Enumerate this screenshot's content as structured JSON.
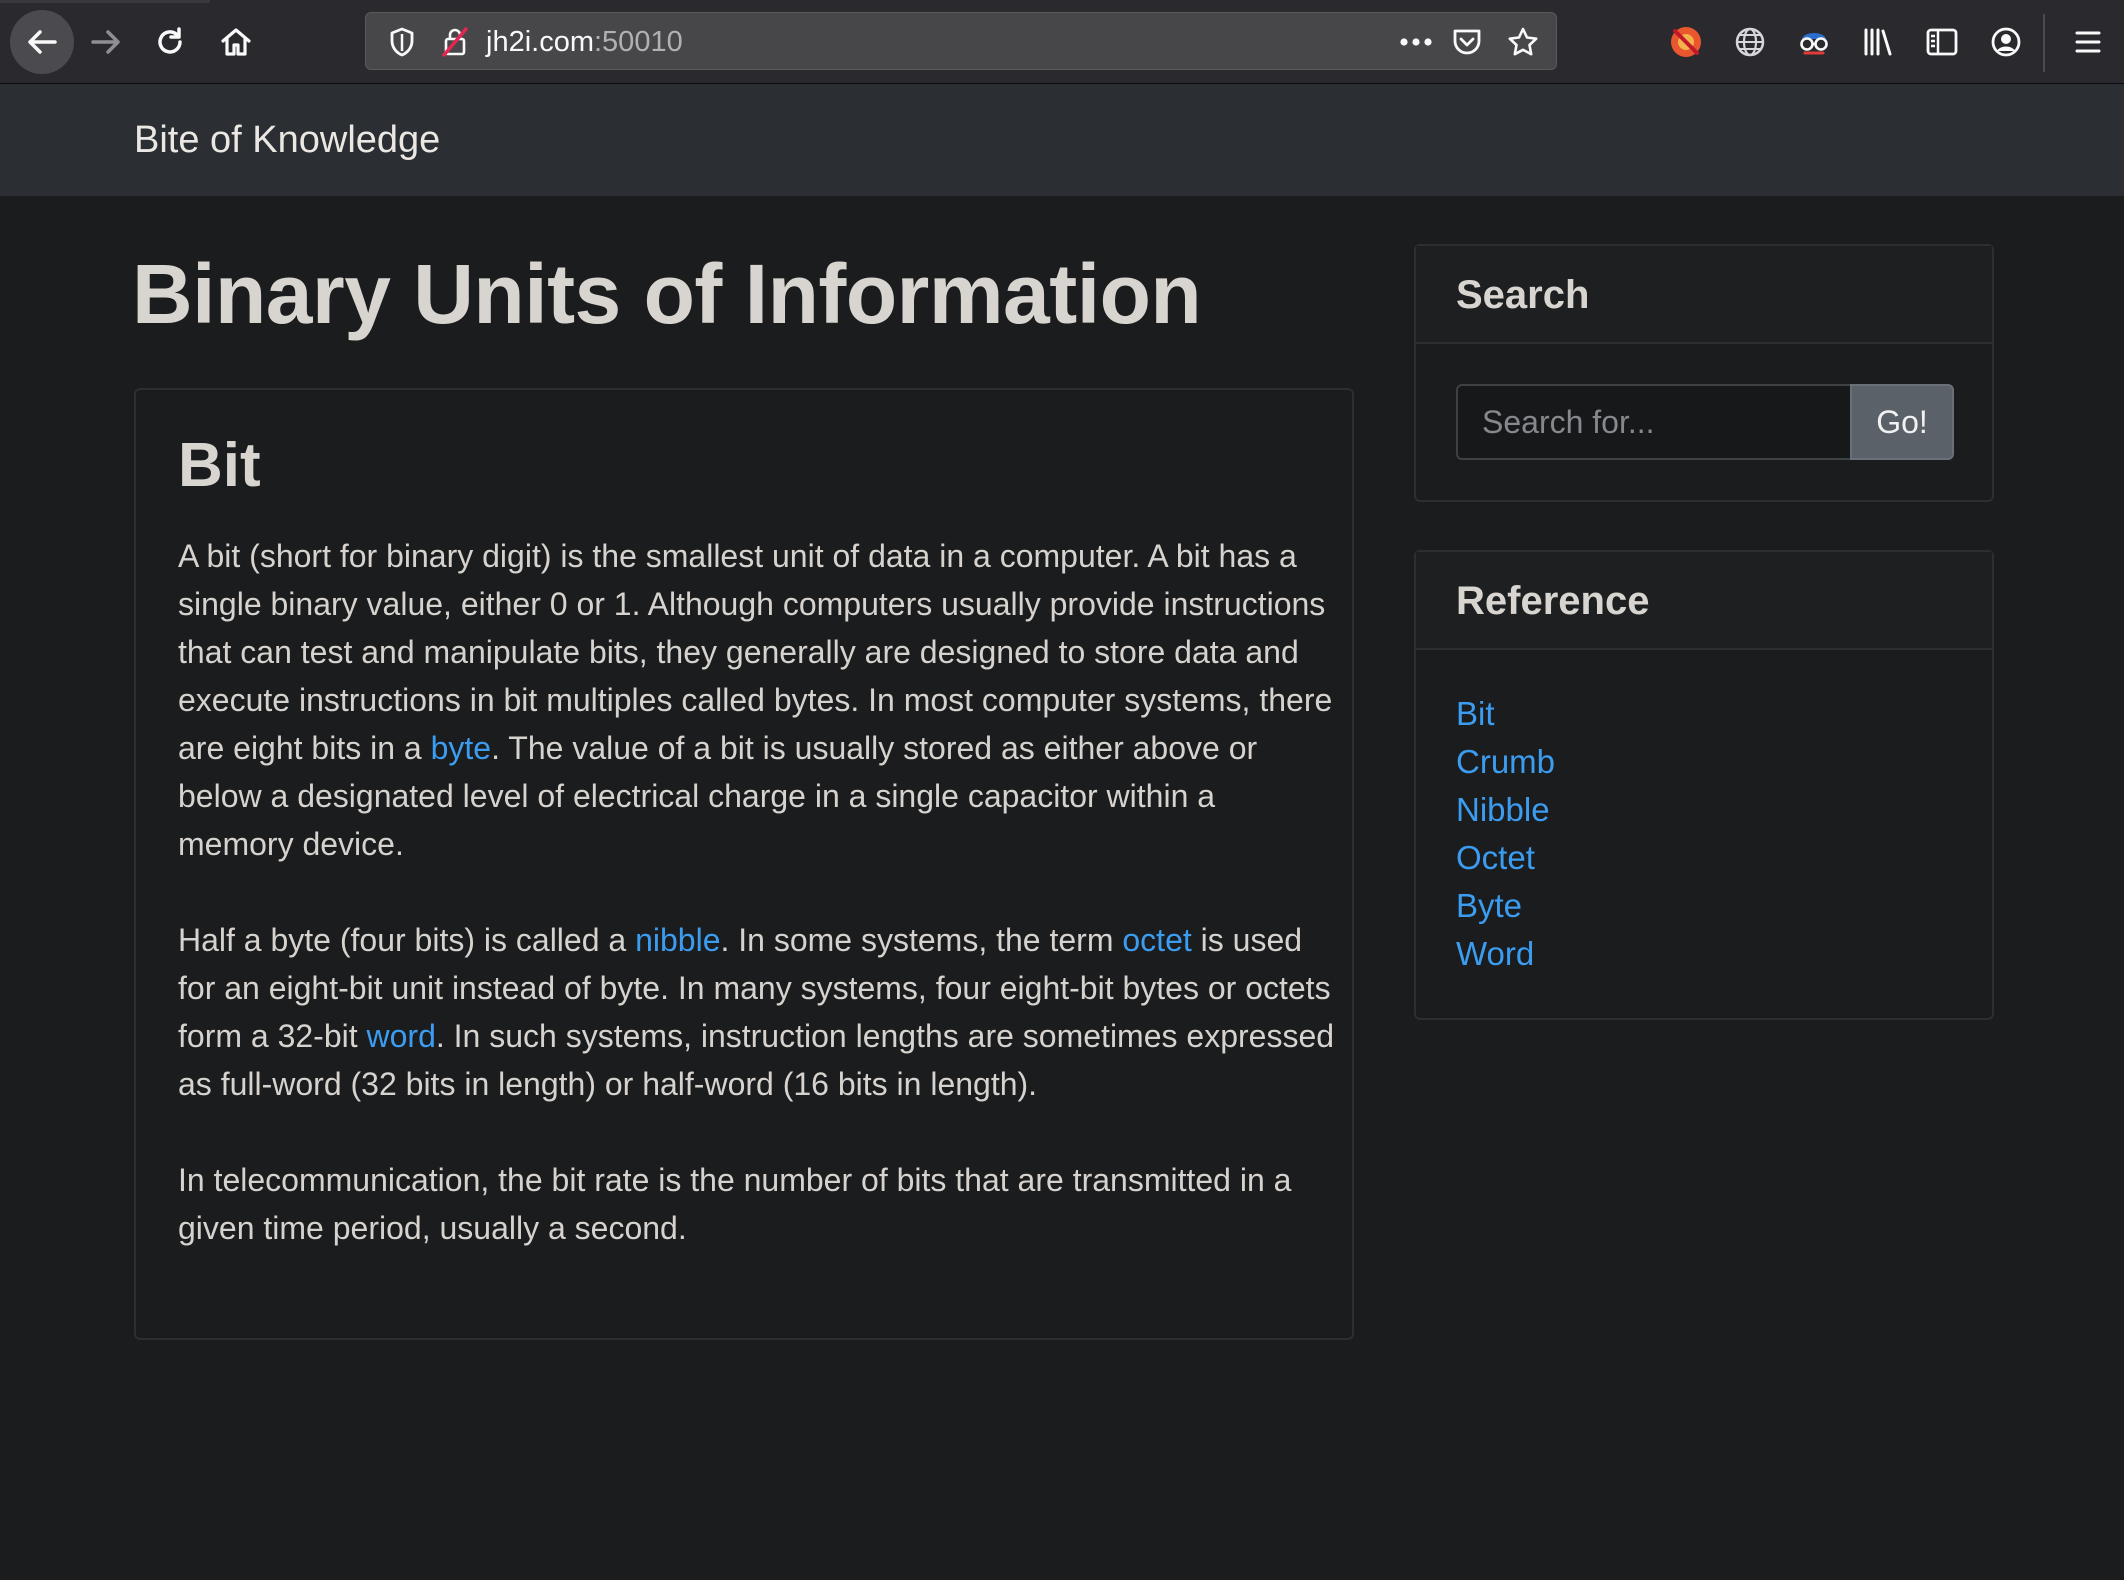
{
  "browser": {
    "url_host": "jh2i.com",
    "url_port": ":50010"
  },
  "site": {
    "brand": "Bite of Knowledge"
  },
  "main": {
    "page_title": "Binary Units of Information",
    "card": {
      "title": "Bit",
      "p1": {
        "t1": "A bit (short for binary digit) is the smallest unit of data in a computer. A bit has a single binary value, either 0 or 1. Although computers usually provide instructions that can test and manipulate bits, they generally are designed to store data and execute instructions in bit multiples called bytes. In most computer systems, there are eight bits in a ",
        "link_byte": "byte",
        "t2": ". The value of a bit is usually stored as either above or below a designated level of electrical charge in a single capacitor within a memory device."
      },
      "p2": {
        "t1": "Half a byte (four bits) is called a ",
        "link_nibble": "nibble",
        "t2": ". In some systems, the term ",
        "link_octet": "octet",
        "t3": " is used for an eight-bit unit instead of byte. In many systems, four eight-bit bytes or octets form a 32-bit ",
        "link_word": "word",
        "t4": ". In such systems, instruction lengths are sometimes expressed as full-word (32 bits in length) or half-word (16 bits in length)."
      },
      "p3": "In telecommunication, the bit rate is the number of bits that are transmitted in a given time period, usually a second."
    }
  },
  "sidebar": {
    "search": {
      "title": "Search",
      "placeholder": "Search for...",
      "button": "Go!"
    },
    "reference": {
      "title": "Reference",
      "items": [
        "Bit",
        "Crumb",
        "Nibble",
        "Octet",
        "Byte",
        "Word"
      ]
    }
  },
  "colors": {
    "link": "#3b9cf0",
    "background": "#1b1c1e",
    "navbar": "#2b2f33"
  }
}
